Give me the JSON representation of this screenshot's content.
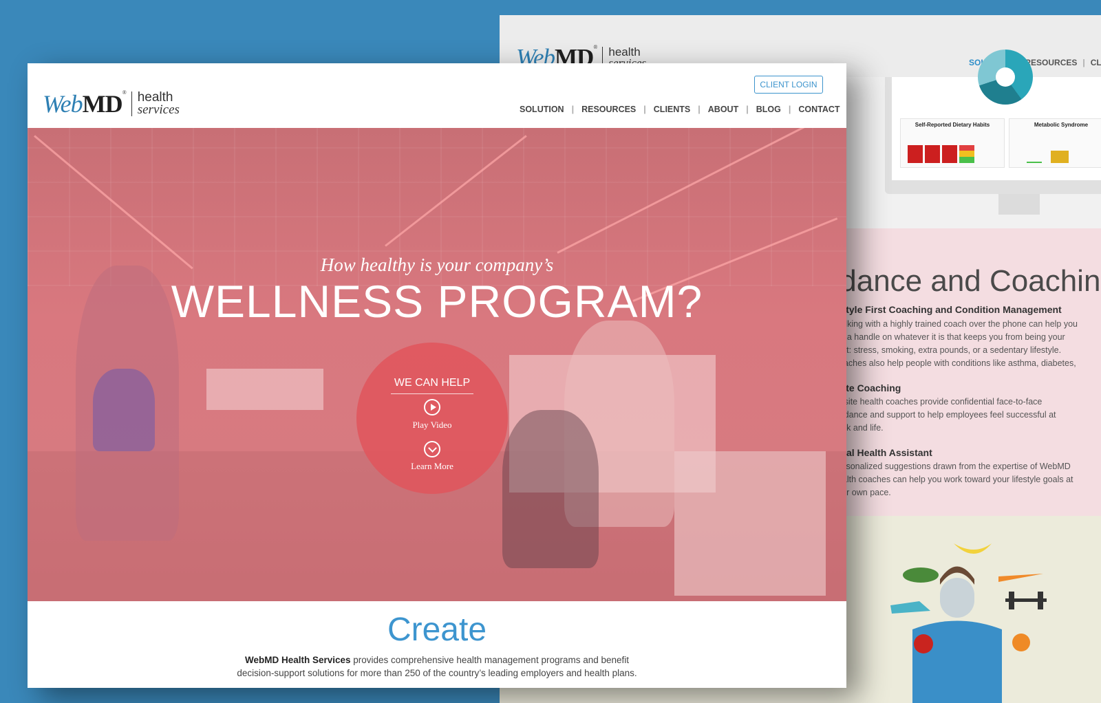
{
  "back_page": {
    "logo": {
      "mark_web": "Web",
      "mark_md": "MD",
      "reg": "®",
      "line1": "health",
      "line2": "services"
    },
    "nav": [
      "SOLUTION",
      "RESOURCES",
      "CLIE"
    ],
    "charts": {
      "panel1_title": "Self-Reported Dietary Habits",
      "panel2_title": "Metabolic Syndrome"
    },
    "guidance": {
      "title": "uidance and Coaching",
      "sections": [
        {
          "heading": "festyle First Coaching and Condition Management",
          "lines": [
            "Walking with a highly trained coach over the phone can help you",
            "get a handle on whatever it is that keeps you from being your",
            "best: stress, smoking, extra pounds, or a sedentary lifestyle.",
            "Coaches also help people with conditions like asthma, diabetes,"
          ]
        },
        {
          "heading": "nsite Coaching",
          "lines": [
            "Onsite health coaches provide confidential face-to-face",
            "guidance and support to help employees feel successful at",
            "work and life."
          ]
        },
        {
          "heading": "igital Health Assistant",
          "lines": [
            "Personalized suggestions drawn from the expertise of WebMD",
            "health coaches can help you work toward your lifestyle goals at",
            "your own pace."
          ]
        }
      ]
    }
  },
  "front_page": {
    "logo": {
      "mark_web": "Web",
      "mark_md": "MD",
      "reg": "®",
      "line1": "health",
      "line2": "services"
    },
    "client_login": "CLIENT LOGIN",
    "nav": [
      "SOLUTION",
      "RESOURCES",
      "CLIENTS",
      "ABOUT",
      "BLOG",
      "CONTACT"
    ],
    "hero": {
      "subtitle": "How healthy is your company’s",
      "title": "WELLNESS PROGRAM?",
      "cta_label": "WE CAN HELP",
      "play_label": "Play Video",
      "learn_label": "Learn More"
    },
    "section": {
      "title": "Create",
      "intro_bold": "WebMD Health Services",
      "intro_rest": " provides comprehensive health management programs and benefit",
      "intro_line2": "decision-support solutions for more than 250 of the country’s leading employers and health plans."
    }
  },
  "colors": {
    "background": "#3a88ba",
    "accent": "#3d95cf",
    "hero_overlay": "#d9787f",
    "cta_circle": "#e0555c"
  }
}
